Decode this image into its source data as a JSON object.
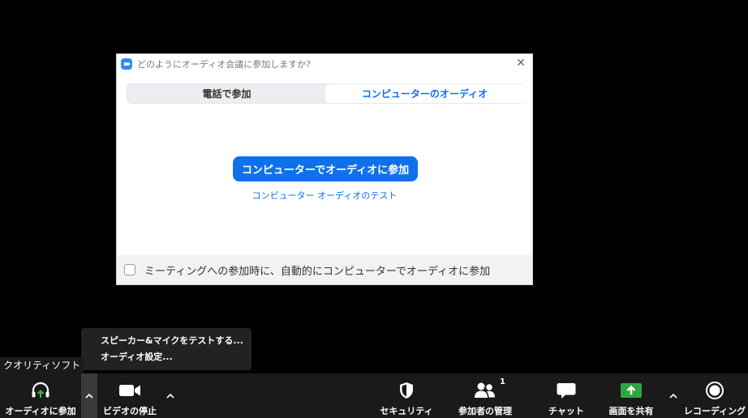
{
  "dialog": {
    "title": "どのようにオーディオ会議に参加しますか?",
    "close_glyph": "✕",
    "tabs": [
      {
        "label": "電話で参加",
        "active": false
      },
      {
        "label": "コンピューターのオーディオ",
        "active": true
      }
    ],
    "join_button": "コンピューターでオーディオに参加",
    "test_link": "コンピューター オーディオのテスト",
    "auto_join_label": "ミーティングへの参加時に、自動的にコンピューターでオーディオに参加",
    "auto_join_checked": false
  },
  "popup_menu": {
    "items": [
      {
        "label": "スピーカー&マイクをテストする..."
      },
      {
        "label": "オーディオ設定..."
      }
    ]
  },
  "quality_label": "クオリティソフト",
  "toolbar": {
    "join_audio": {
      "label": "オーディオに参加",
      "icon": "headphones-icon"
    },
    "stop_video": {
      "label": "ビデオの停止",
      "icon": "video-camera-icon"
    },
    "security": {
      "label": "セキュリティ",
      "icon": "shield-icon"
    },
    "participants": {
      "label": "参加者の管理",
      "icon": "participants-icon",
      "count": "1"
    },
    "chat": {
      "label": "チャット",
      "icon": "chat-bubble-icon"
    },
    "share_screen": {
      "label": "画面を共有",
      "icon": "share-screen-icon"
    },
    "recording": {
      "label": "レコーディング",
      "icon": "record-icon"
    }
  },
  "colors": {
    "accent_blue": "#0e71eb",
    "share_green": "#2ca83f",
    "audio_green": "#3fb950",
    "toolbar_bg": "#1a1a1a"
  }
}
